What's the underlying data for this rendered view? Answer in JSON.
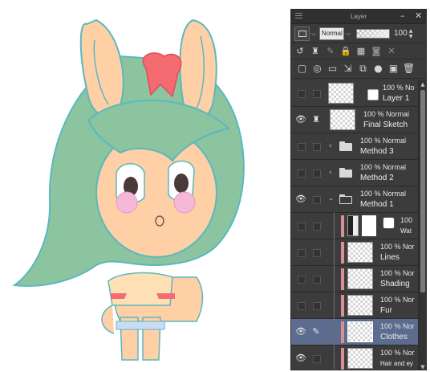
{
  "panel": {
    "title": "Layer",
    "blend_mode_value": "Normal",
    "opacity_value": "100",
    "minimize_icon": "minimize-icon",
    "close_icon": "close-icon"
  },
  "layers": [
    {
      "opacity_mode": "100 % Normal",
      "name": "Layer 1",
      "visible": false,
      "type": "raster"
    },
    {
      "opacity_mode": "100 % Normal",
      "name": "Final Sketch",
      "visible": true,
      "type": "raster"
    },
    {
      "opacity_mode": "100 % Normal",
      "name": "Method 3",
      "visible": false,
      "type": "folder-closed"
    },
    {
      "opacity_mode": "100 % Normal",
      "name": "Method 2",
      "visible": false,
      "type": "folder-closed"
    },
    {
      "opacity_mode": "100 % Normal",
      "name": "Method 1",
      "visible": true,
      "type": "folder-open"
    },
    {
      "opacity_mode": "100",
      "name": "Wat",
      "visible": false,
      "type": "child-mask"
    },
    {
      "opacity_mode": "100 % Nor",
      "name": "Lines",
      "visible": false,
      "type": "child"
    },
    {
      "opacity_mode": "100 % Nor",
      "name": "Shading",
      "visible": false,
      "type": "child"
    },
    {
      "opacity_mode": "100 % Nor",
      "name": "Fur",
      "visible": false,
      "type": "child"
    },
    {
      "opacity_mode": "100 % Nor",
      "name": "Clothes",
      "visible": true,
      "type": "child",
      "selected": true
    },
    {
      "opacity_mode": "100 % Nor",
      "name": "Hair and ey",
      "visible": true,
      "type": "child"
    }
  ],
  "colors": {
    "panel_bg": "#3a3a3a",
    "selected_row": "#5c6c8e",
    "hair": "#8cc4a0",
    "skin": "#ffcfa5",
    "bow": "#f56b72",
    "outline": "#5ab8c0",
    "clip_bar": "#d98f94"
  }
}
